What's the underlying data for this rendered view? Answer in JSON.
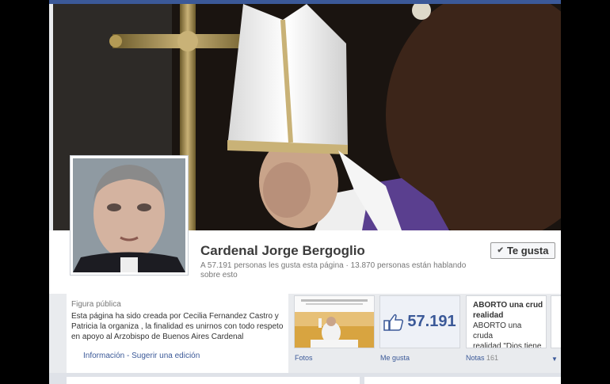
{
  "page": {
    "name": "Cardenal Jorge Bergoglio",
    "stats": "A 57.191 personas les gusta esta página · 13.870 personas están hablando sobre esto",
    "like_button_label": "Te gusta",
    "category": "Figura pública",
    "description": "Esta página ha sido creada por Cecilia Fernandez Castro y Patricia la organiza , la finalidad es unirnos con todo respeto en apoyo al Arzobispo de Buenos Aires Cardenal",
    "info_links": "Información - Sugerir una edición"
  },
  "apps": {
    "photos_label": "Fotos",
    "likes_label": "Me gusta",
    "likes_count": "57.191",
    "notes_label": "Notas",
    "notes_count": "161",
    "notes_preview": {
      "title": "ABORTO una crud realidad",
      "line1": "ABORTO una cruda",
      "line2": "realidad \"Dios tiene"
    }
  },
  "icons": {
    "like": "thumbs-up-icon",
    "check": "check-icon",
    "expand": "chevron-down-icon"
  },
  "colors": {
    "brand": "#3b5998",
    "background": "#e9ebee"
  }
}
